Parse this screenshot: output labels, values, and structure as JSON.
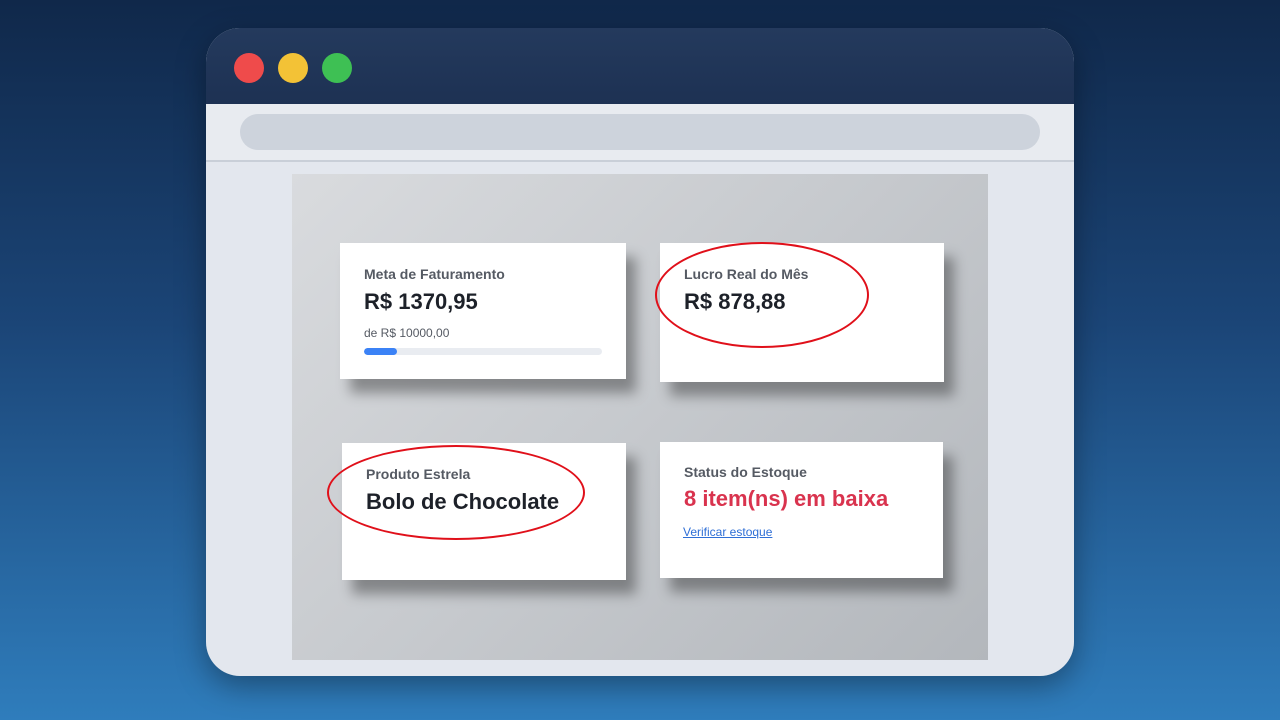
{
  "browser": {
    "controls": [
      "close-dot",
      "minimize-dot",
      "maximize-dot"
    ]
  },
  "dashboard": {
    "revenue_goal": {
      "label": "Meta de Faturamento",
      "value": "R$ 1370,95",
      "target_text": "de R$ 10000,00",
      "progress_percent": 13.7
    },
    "real_profit": {
      "label": "Lucro Real do Mês",
      "value": "R$ 878,88"
    },
    "star_product": {
      "label": "Produto Estrela",
      "value": "Bolo de Chocolate"
    },
    "stock_status": {
      "label": "Status do Estoque",
      "value": "8 item(ns) em baixa",
      "link": "Verificar estoque"
    }
  },
  "colors": {
    "alert": "#d9334e",
    "link": "#2f6fd6",
    "highlight_circle": "#e0101a"
  }
}
